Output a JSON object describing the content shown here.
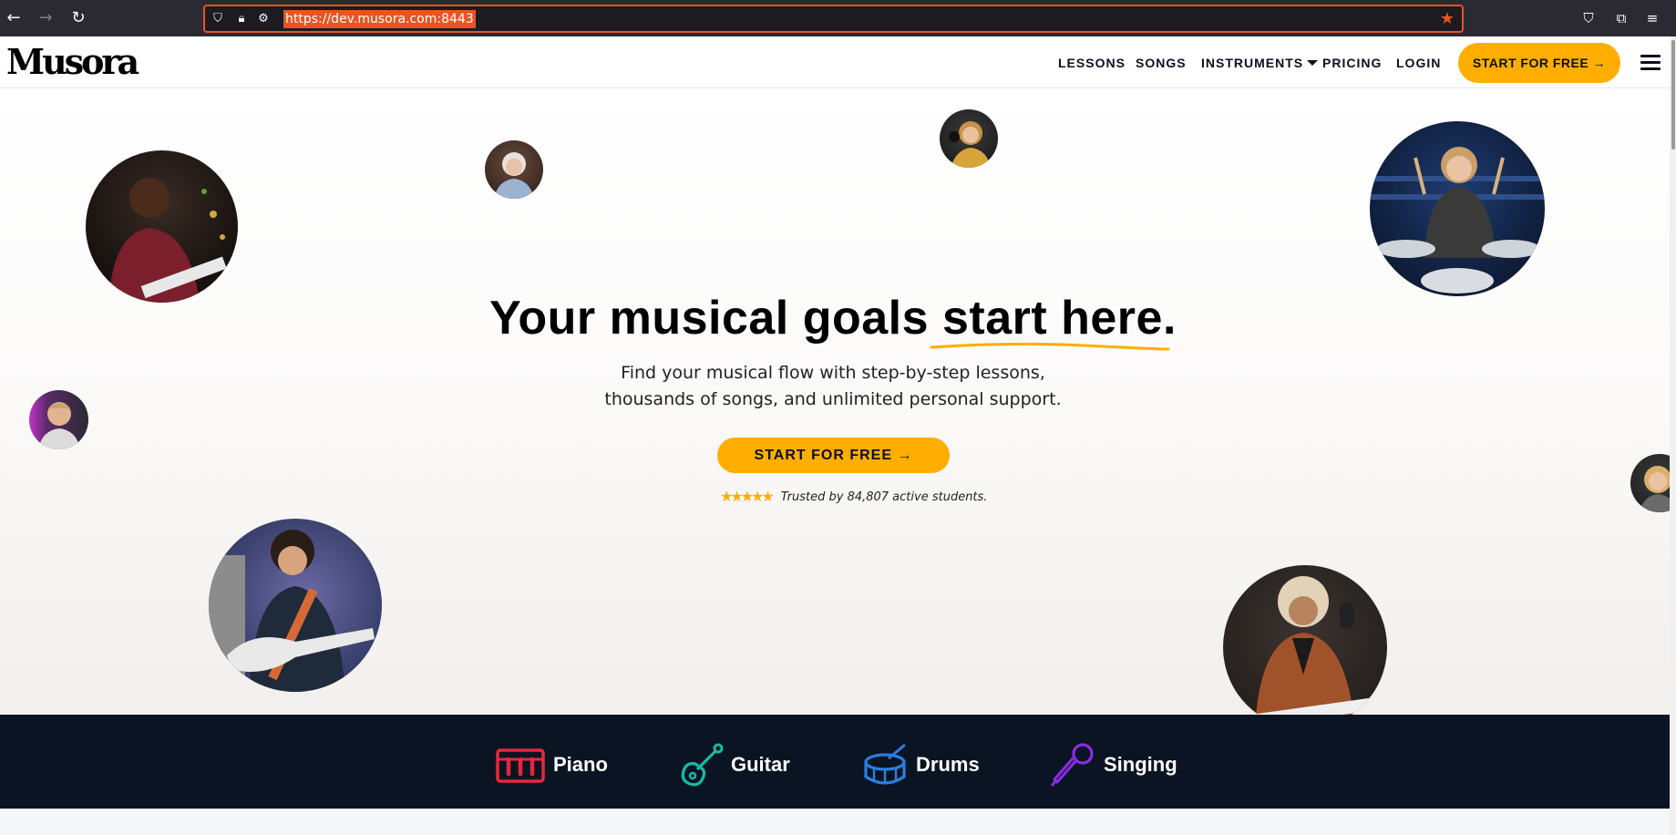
{
  "browser": {
    "url": "https://dev.musora.com:8443"
  },
  "header": {
    "logo": "Musora",
    "nav": {
      "lessons": "LESSONS",
      "songs": "SONGS",
      "instruments": "INSTRUMENTS",
      "pricing": "PRICING",
      "login": "LOGIN"
    },
    "cta_label": "START FOR FREE →"
  },
  "hero": {
    "title_part1": "Your musical goals ",
    "title_part2": "start here.",
    "subtitle_line1": "Find your musical flow with step-by-step lessons,",
    "subtitle_line2": "thousands of songs, and unlimited personal support.",
    "cta_label": "START FOR FREE →",
    "stars": "★★★★★",
    "trust_text": "Trusted by 84,807 active students."
  },
  "instruments": {
    "piano": "Piano",
    "guitar": "Guitar",
    "drums": "Drums",
    "singing": "Singing"
  },
  "colors": {
    "accent": "#ffae00",
    "navy": "#0b1423",
    "piano": "#e8273c",
    "guitar": "#19b8a4",
    "drums": "#2b7de0",
    "singing": "#8a2be2"
  }
}
